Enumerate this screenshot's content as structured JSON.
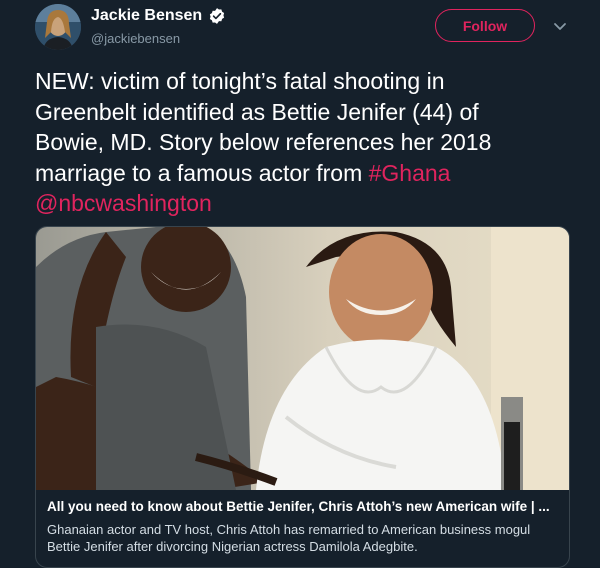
{
  "user": {
    "name": "Jackie Bensen",
    "handle": "@jackiebensen"
  },
  "actions": {
    "follow_label": "Follow"
  },
  "tweet": {
    "text_line1": "NEW: victim of tonight’s fatal shooting in",
    "text_line2": "Greenbelt identified as Bettie Jenifer (44) of",
    "text_line3": "Bowie, MD.  Story below references her 2018",
    "text_line4": "marriage to a famous actor from ",
    "hashtag": "#Ghana",
    "mention": "@nbcwashington"
  },
  "card": {
    "title": "All you need to know about Bettie Jenifer, Chris Attoh’s new American wife | ...",
    "description": "Ghanaian actor and TV host, Chris Attoh has remarried to American business mogul Bettie Jenifer after divorcing Nigerian actress Damilola Adegbite."
  },
  "colors": {
    "background": "#15202b",
    "accent": "#e0245e",
    "secondary_text": "#8899a6",
    "verified": "#ffffff"
  },
  "icons": {
    "verified": "verified-badge-icon",
    "more": "chevron-down-icon"
  }
}
